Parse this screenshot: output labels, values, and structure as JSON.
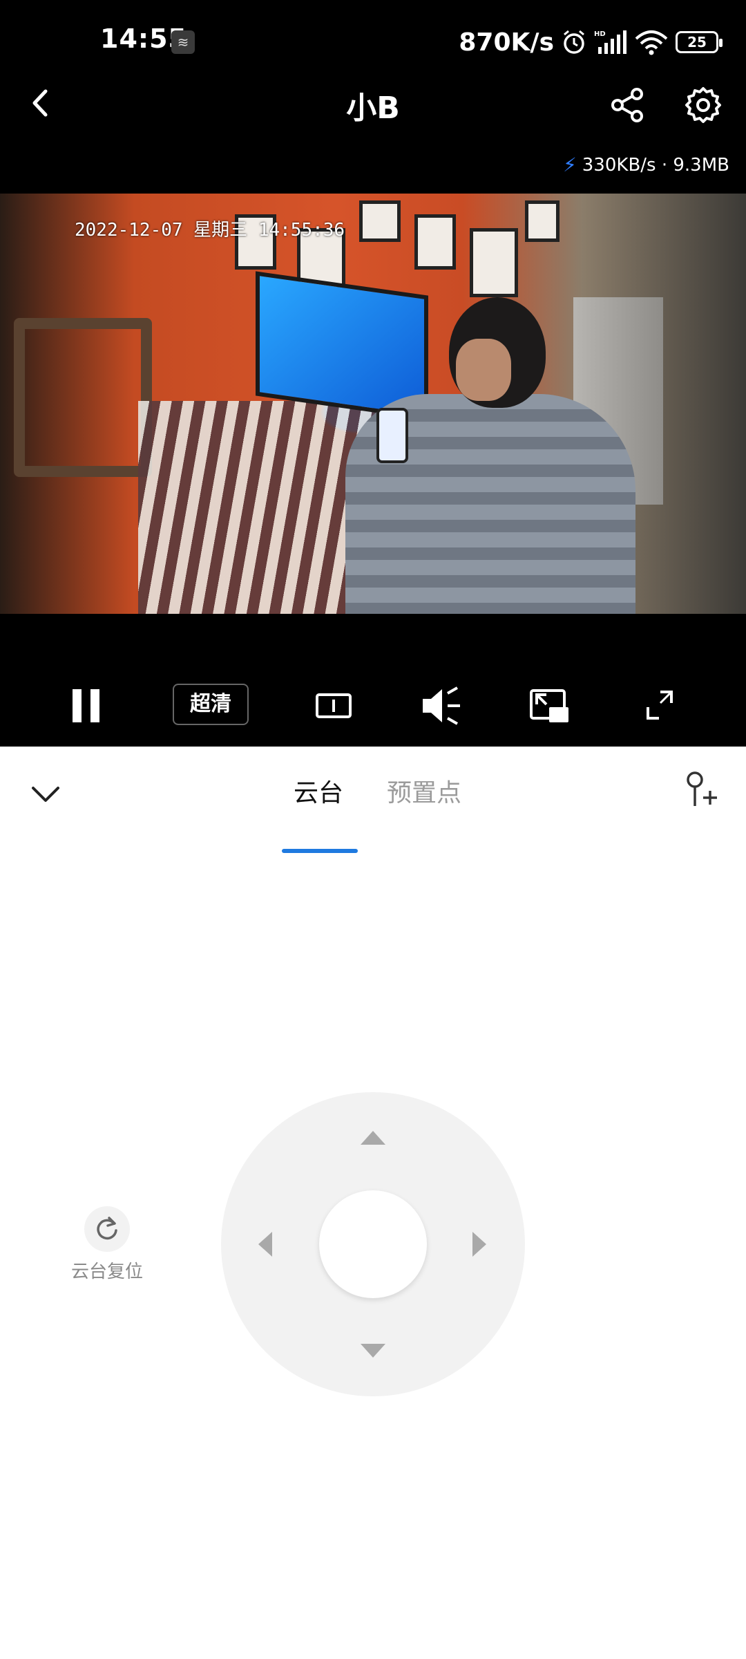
{
  "status_bar": {
    "time": "14:55",
    "notification_icon": "notification-icon",
    "net_speed": "870K/s",
    "battery": "25",
    "icons": [
      "alarm-icon",
      "hd-signal-icon",
      "wifi-icon",
      "battery-icon"
    ]
  },
  "header": {
    "title": "小B",
    "back_icon": "back-chevron-icon",
    "share_icon": "share-icon",
    "settings_icon": "gear-icon"
  },
  "stream_stats": {
    "text": "330KB/s · 9.3MB",
    "icon": "bolt-icon"
  },
  "video": {
    "timestamp": "2022-12-07 星期三 14:55:36"
  },
  "controls": {
    "pause_icon": "pause-icon",
    "quality_label": "超清",
    "stream_icon": "stream-icon",
    "mute_icon": "volume-icon",
    "pip_icon": "picture-in-picture-icon",
    "fullscreen_icon": "fullscreen-icon"
  },
  "panel": {
    "collapse_icon": "chevron-down-icon",
    "tabs": [
      {
        "label": "云台",
        "active": true
      },
      {
        "label": "预置点",
        "active": false
      }
    ],
    "add_preset_icon": "add-location-icon",
    "reset_label": "云台复位",
    "accent_color": "#1f7ae0"
  }
}
